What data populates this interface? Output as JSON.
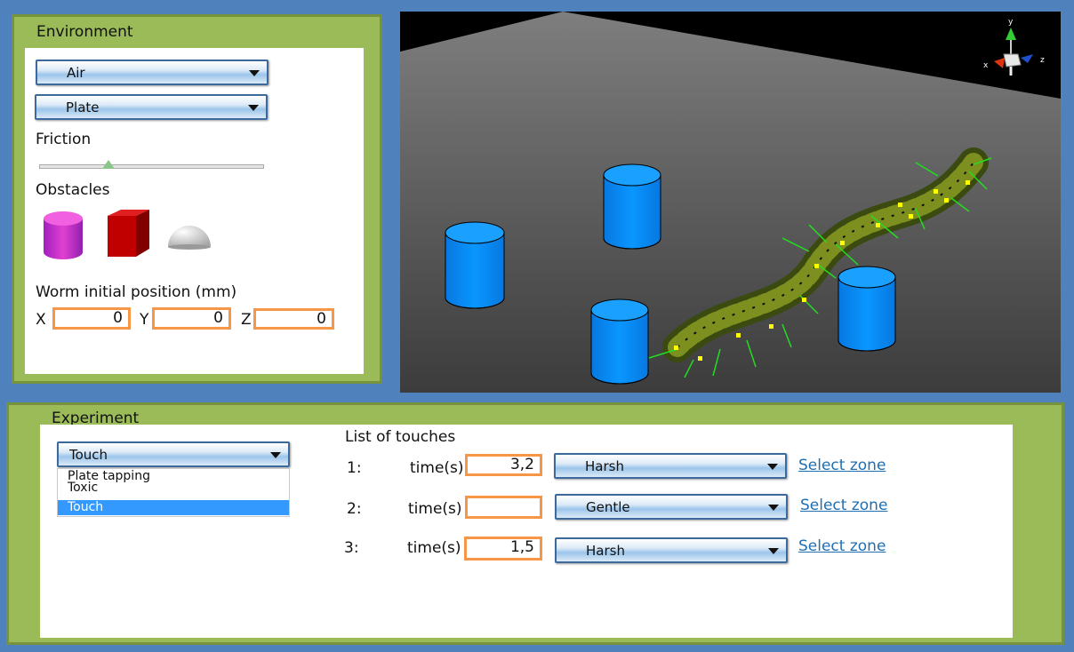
{
  "environment": {
    "title": "Environment",
    "medium_select": "Air",
    "surface_select": "Plate",
    "friction_label": "Friction",
    "friction_value": 0.3,
    "obstacles_label": "Obstacles",
    "obstacle_icons": [
      "cylinder-obstacle-icon",
      "cube-obstacle-icon",
      "hemisphere-obstacle-icon"
    ],
    "position_label": "Worm initial position (mm)",
    "x_label": "X",
    "x_value": "0",
    "y_label": "Y",
    "y_value": "0",
    "z_label": "Z",
    "z_value": "0"
  },
  "viewport": {
    "axis_labels": {
      "x": "x",
      "y": "y",
      "z": "z"
    }
  },
  "experiment": {
    "title": "Experiment",
    "type_select": "Touch",
    "type_options": [
      "Plate tapping",
      "Toxic",
      "Touch"
    ],
    "selected_option": "Touch",
    "touches_title": "List of touches",
    "time_label": "time(s)",
    "select_zone_label": "Select zone",
    "touches": [
      {
        "index": "1:",
        "time": "3,2",
        "intensity": "Harsh"
      },
      {
        "index": "2:",
        "time": "",
        "intensity": "Gentle"
      },
      {
        "index": "3:",
        "time": "1,5",
        "intensity": "Harsh"
      }
    ]
  },
  "colors": {
    "background": "#4f81bd",
    "panel_green": "#9bbb59",
    "input_border": "#f79646",
    "obstacle_blue": "#0a8cff"
  }
}
